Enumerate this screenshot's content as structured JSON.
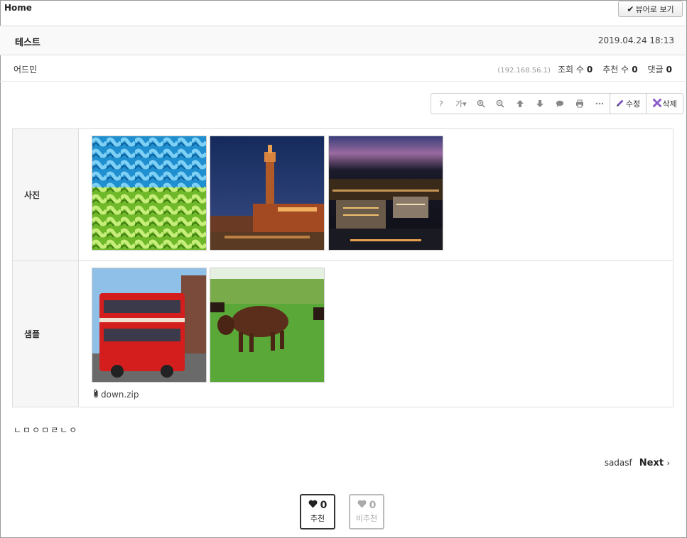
{
  "header": {
    "home": "Home",
    "viewer_button": "뷰어로 보기"
  },
  "post": {
    "title": "테스트",
    "date": "2019.04.24 18:13",
    "author": "어드민",
    "ip": "(192.168.56.1)",
    "views_label": "조회 수",
    "views": "0",
    "likes_label": "추천 수",
    "likes": "0",
    "comments_label": "댓글",
    "comments": "0",
    "body": "ㄴㅁㅇㅁㄹㄴㅇ"
  },
  "toolbar": {
    "help": "?",
    "font": "가",
    "edit": "수정",
    "delete": "삭제",
    "icons": [
      "help-icon",
      "font-size-icon",
      "zoom-in-icon",
      "zoom-out-icon",
      "arrow-up-icon",
      "arrow-down-icon",
      "comment-icon",
      "print-icon",
      "more-icon",
      "pencil-icon",
      "delete-x-icon"
    ]
  },
  "fields": [
    {
      "label": "사진",
      "images": [
        "blue-green-weave-photo",
        "clock-tower-night-photo",
        "city-night-aerial-photo"
      ]
    },
    {
      "label": "샘플",
      "images": [
        "red-double-decker-bus-photo",
        "brown-cow-field-photo"
      ],
      "file": "down.zip"
    }
  ],
  "navigation": {
    "prev_title": "sadasf",
    "next": "Next"
  },
  "votes": {
    "up_count": "0",
    "up_label": "추천",
    "down_count": "0",
    "down_label": "비추천"
  },
  "colors": {
    "border": "#dddddd",
    "label_bg": "#f6f6f6",
    "delete_x": "#8a5cc8"
  }
}
